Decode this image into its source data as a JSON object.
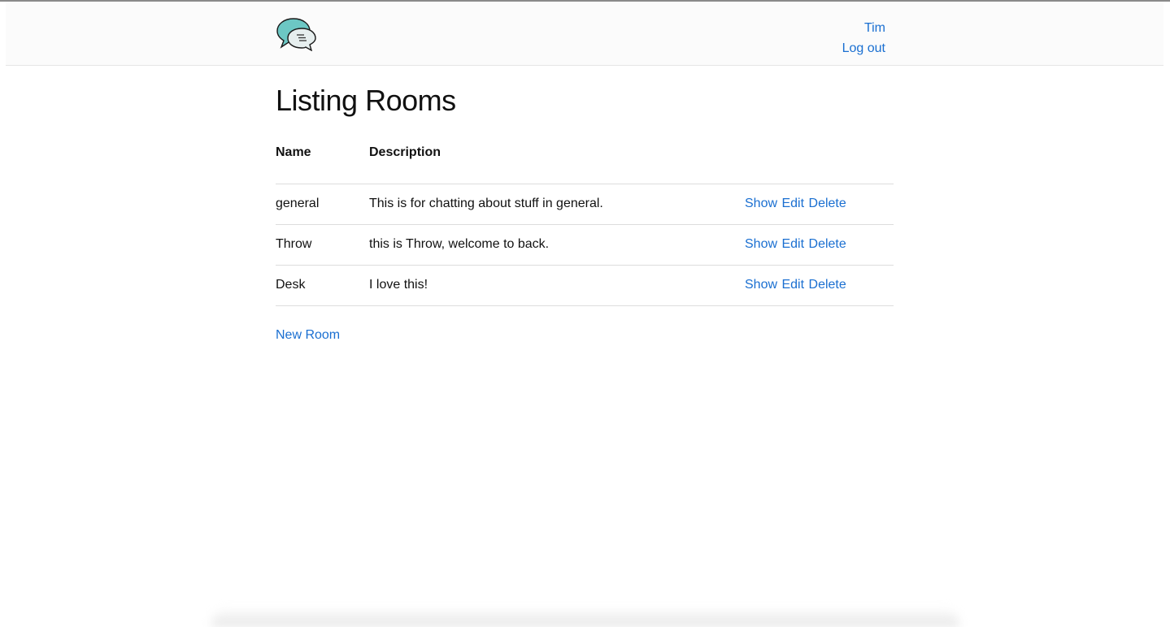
{
  "header": {
    "logo_icon": "chat-bubbles-icon",
    "user_name": "Tim",
    "logout_label": "Log out"
  },
  "page": {
    "title": "Listing Rooms"
  },
  "table": {
    "headers": [
      "Name",
      "Description",
      ""
    ],
    "rows": [
      {
        "name": "general",
        "description": "This is for chatting about stuff in general.",
        "show": "Show",
        "edit": "Edit",
        "delete": "Delete"
      },
      {
        "name": "Throw",
        "description": "this is Throw, welcome to back.",
        "show": "Show",
        "edit": "Edit",
        "delete": "Delete"
      },
      {
        "name": "Desk",
        "description": "I love this!",
        "show": "Show",
        "edit": "Edit",
        "delete": "Delete"
      }
    ]
  },
  "actions": {
    "new_room_label": "New Room"
  },
  "colors": {
    "link": "#1a6fd1",
    "header_bg": "#fbfbfb",
    "logo_teal": "#6cc7c4"
  }
}
